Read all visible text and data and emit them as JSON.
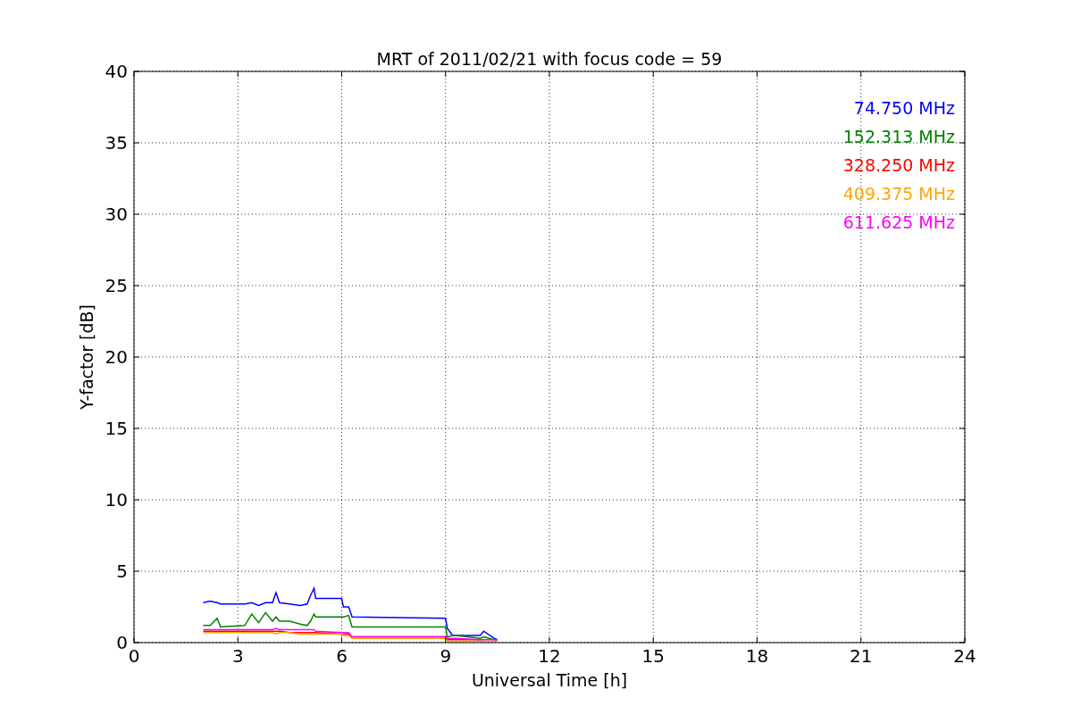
{
  "chart_data": {
    "type": "line",
    "title": "MRT of 2011/02/21 with focus code = 59",
    "xlabel": "Universal Time [h]",
    "ylabel": "Y-factor [dB]",
    "grid": true,
    "xlim": [
      0,
      24
    ],
    "ylim": [
      0,
      40
    ],
    "xticks": [
      0,
      3,
      6,
      9,
      12,
      15,
      18,
      21,
      24
    ],
    "yticks": [
      0,
      5,
      10,
      15,
      20,
      25,
      30,
      35,
      40
    ],
    "x": [
      2.0,
      2.2,
      2.4,
      2.5,
      3.2,
      3.4,
      3.6,
      3.8,
      4.0,
      4.1,
      4.2,
      4.5,
      4.8,
      5.0,
      5.1,
      5.2,
      5.25,
      6.0,
      6.05,
      6.2,
      6.3,
      9.0,
      9.05,
      9.2,
      9.3,
      10.0,
      10.1,
      10.4,
      10.5
    ],
    "series": [
      {
        "name": "74.750 MHz",
        "color": "#0000ff",
        "values": [
          2.8,
          2.9,
          2.8,
          2.7,
          2.7,
          2.8,
          2.6,
          2.8,
          2.8,
          3.5,
          2.8,
          2.7,
          2.6,
          2.7,
          3.3,
          3.8,
          3.1,
          3.1,
          2.5,
          2.5,
          1.8,
          1.7,
          1.0,
          0.5,
          0.5,
          0.5,
          0.8,
          0.3,
          0.2
        ]
      },
      {
        "name": "152.313 MHz",
        "color": "#008000",
        "values": [
          1.2,
          1.2,
          1.7,
          1.1,
          1.2,
          2.0,
          1.4,
          2.1,
          1.5,
          1.8,
          1.5,
          1.5,
          1.3,
          1.2,
          1.5,
          2.0,
          1.8,
          1.8,
          1.8,
          1.9,
          1.1,
          1.1,
          0.4,
          0.5,
          0.5,
          0.3,
          0.4,
          0.2,
          0.2
        ]
      },
      {
        "name": "328.250 MHz",
        "color": "#ff0000",
        "values": [
          0.8,
          0.8,
          0.8,
          0.8,
          0.8,
          0.8,
          0.8,
          0.8,
          0.8,
          0.8,
          0.8,
          0.7,
          0.7,
          0.7,
          0.7,
          0.7,
          0.7,
          0.6,
          0.6,
          0.6,
          0.4,
          0.4,
          0.2,
          0.2,
          0.2,
          0.2,
          0.2,
          null,
          null
        ]
      },
      {
        "name": "409.375 MHz",
        "color": "#ffa500",
        "values": [
          0.7,
          0.7,
          0.7,
          0.7,
          0.7,
          0.7,
          0.7,
          0.7,
          0.7,
          0.6,
          0.7,
          0.7,
          0.6,
          0.6,
          0.6,
          0.6,
          0.6,
          0.6,
          0.5,
          0.5,
          0.3,
          0.3,
          0.1,
          0.1,
          0.1,
          0.1,
          0.1,
          0.1,
          0.1
        ]
      },
      {
        "name": "611.625 MHz",
        "color": "#ff00ff",
        "values": [
          0.9,
          0.9,
          0.9,
          0.9,
          0.9,
          0.9,
          0.9,
          0.9,
          0.9,
          1.0,
          0.9,
          0.9,
          0.9,
          0.9,
          0.9,
          0.9,
          0.8,
          0.7,
          0.7,
          0.7,
          0.4,
          0.4,
          0.3,
          0.3,
          0.3,
          0.2,
          0.2,
          0.2,
          0.2
        ]
      }
    ]
  }
}
